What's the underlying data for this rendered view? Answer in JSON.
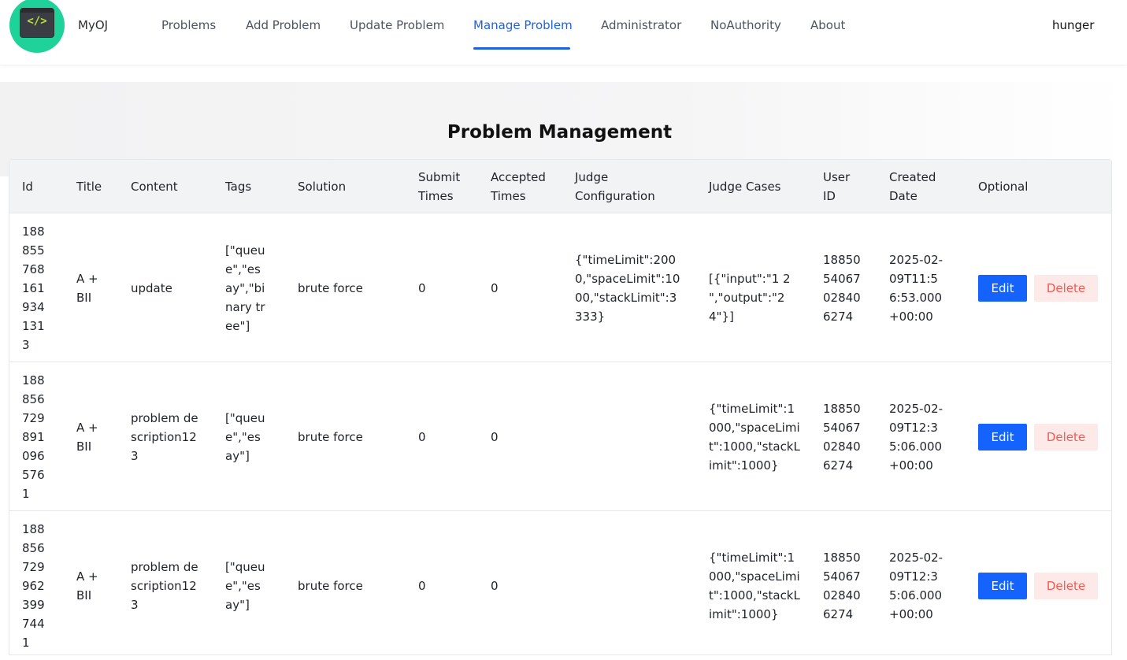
{
  "header": {
    "logo_icon": "code-terminal-icon",
    "logo_code": "</>",
    "brand": "MyOJ",
    "nav": [
      {
        "label": "Problems",
        "active": false
      },
      {
        "label": "Add Problem",
        "active": false
      },
      {
        "label": "Update Problem",
        "active": false
      },
      {
        "label": "Manage Problem",
        "active": true
      },
      {
        "label": "Administrator",
        "active": false
      },
      {
        "label": "NoAuthority",
        "active": false
      },
      {
        "label": "About",
        "active": false
      }
    ],
    "user": "hunger"
  },
  "page": {
    "title": "Problem Management"
  },
  "table": {
    "columns": {
      "id": "Id",
      "title": "Title",
      "content": "Content",
      "tags": "Tags",
      "solution": "Solution",
      "submit_times": "Submit Times",
      "accepted_times": "Accepted Times",
      "judge_configuration": "Judge Configuration",
      "judge_cases": "Judge Cases",
      "user_id": "User ID",
      "created_date": "Created Date",
      "optional": "Optional"
    },
    "rows": [
      {
        "id": "1888557681619341313",
        "title": "A + BII",
        "content": "update",
        "tags": "[\"queue\",\"esay\",\"binary tree\"]",
        "solution": "brute force",
        "submit_times": "0",
        "accepted_times": "0",
        "judge_configuration": "{\"timeLimit\":2000,\"spaceLimit\":1000,\"stackLimit\":3333}",
        "judge_cases": "[{\"input\":\"1 2 \",\"output\":\"2 4\"}]",
        "user_id": "1885054067028406274",
        "created_date": "2025-02-09T11:56:53.000+00:00",
        "edit_label": "Edit",
        "delete_label": "Delete"
      },
      {
        "id": "1888567298910965761",
        "title": "A + BII",
        "content": "problem description123",
        "tags": "[\"queue\",\"esay\"]",
        "solution": "brute force",
        "submit_times": "0",
        "accepted_times": "0",
        "judge_configuration": "",
        "judge_cases": "{\"timeLimit\":1000,\"spaceLimit\":1000,\"stackLimit\":1000}",
        "user_id": "1885054067028406274",
        "created_date": "2025-02-09T12:35:06.000+00:00",
        "edit_label": "Edit",
        "delete_label": "Delete"
      },
      {
        "id": "1888567299623997441",
        "title": "A + BII",
        "content": "problem description123",
        "tags": "[\"queue\",\"esay\"]",
        "solution": "brute force",
        "submit_times": "0",
        "accepted_times": "0",
        "judge_configuration": "",
        "judge_cases": "{\"timeLimit\":1000,\"spaceLimit\":1000,\"stackLimit\":1000}",
        "user_id": "1885054067028406274",
        "created_date": "2025-02-09T12:35:06.000+00:00",
        "edit_label": "Edit",
        "delete_label": "Delete"
      }
    ]
  },
  "colors": {
    "accent": "#1e62dd",
    "logo_bg": "#1ed29a",
    "edit_button": "#1463ff",
    "delete_button_bg": "#fde9e7",
    "delete_button_text": "#f25a52"
  }
}
